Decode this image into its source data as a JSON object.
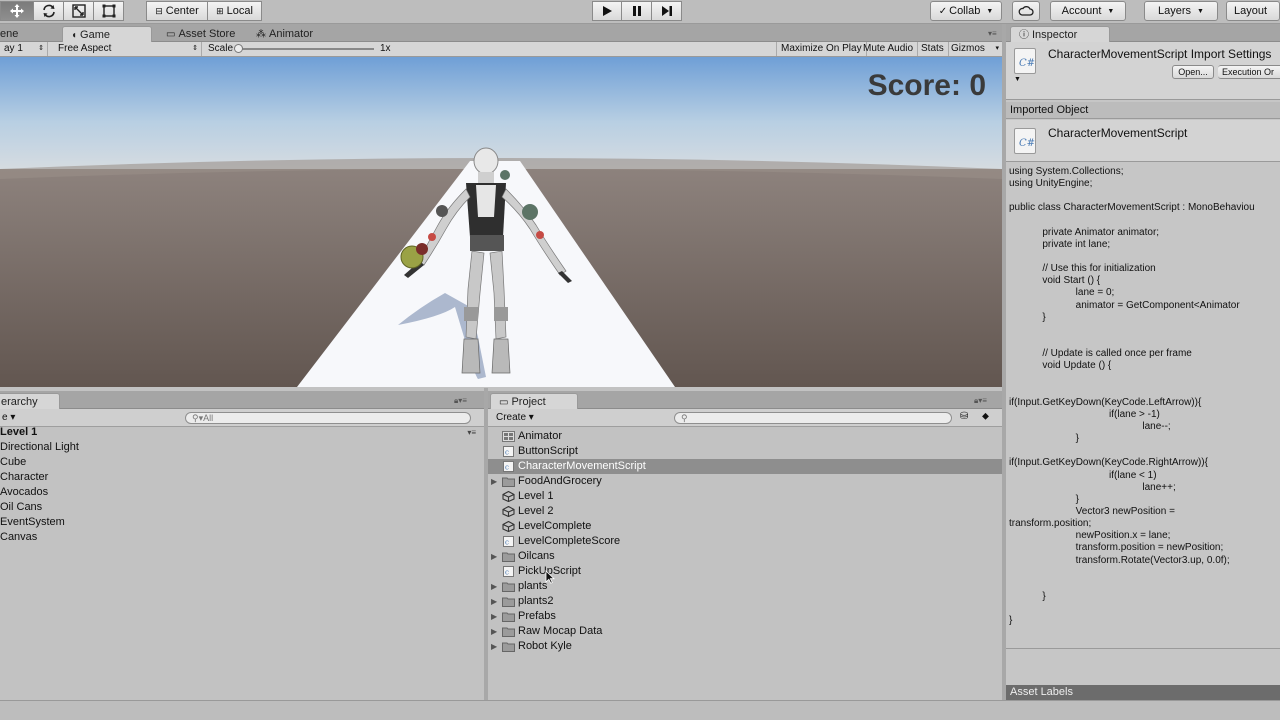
{
  "toolbar": {
    "pivot_label": "Center",
    "rotation_label": "Local",
    "collab_label": "Collab",
    "account_label": "Account",
    "layers_label": "Layers",
    "layout_label": "Layout"
  },
  "tabs": {
    "scene": "ene",
    "game": "Game",
    "asset_store": "Asset Store",
    "animator": "Animator",
    "inspector": "Inspector",
    "hierarchy": "erarchy",
    "project": "Project"
  },
  "game_bar": {
    "display": "ay 1",
    "aspect": "Free Aspect",
    "scale_label": "Scale",
    "scale_value": "1x",
    "maximize": "Maximize On Play",
    "mute": "Mute Audio",
    "stats": "Stats",
    "gizmos": "Gizmos"
  },
  "game_view": {
    "score_text": "Score: 0"
  },
  "hierarchy": {
    "create_label": "e",
    "search_placeholder": "All",
    "scene_name": "Level 1",
    "items": [
      "Directional Light",
      "Cube",
      "Character",
      "Avocados",
      "Oil Cans",
      "EventSystem",
      "Canvas"
    ]
  },
  "project": {
    "create_label": "Create",
    "items": [
      {
        "name": "Animator",
        "icon": "animator-icon"
      },
      {
        "name": "ButtonScript",
        "icon": "csharp-script-icon"
      },
      {
        "name": "CharacterMovementScript",
        "icon": "csharp-script-icon",
        "selected": true
      },
      {
        "name": "FoodAndGrocery",
        "icon": "folder-icon",
        "expandable": true
      },
      {
        "name": "Level 1",
        "icon": "unity-scene-icon"
      },
      {
        "name": "Level 2",
        "icon": "unity-scene-icon"
      },
      {
        "name": "LevelComplete",
        "icon": "unity-scene-icon"
      },
      {
        "name": "LevelCompleteScore",
        "icon": "csharp-script-icon"
      },
      {
        "name": "Oilcans",
        "icon": "folder-icon",
        "expandable": true
      },
      {
        "name": "PickUpScript",
        "icon": "csharp-script-icon"
      },
      {
        "name": "plants",
        "icon": "folder-icon",
        "expandable": true
      },
      {
        "name": "plants2",
        "icon": "folder-icon",
        "expandable": true
      },
      {
        "name": "Prefabs",
        "icon": "folder-icon",
        "expandable": true
      },
      {
        "name": "Raw Mocap Data",
        "icon": "folder-icon",
        "expandable": true
      },
      {
        "name": "Robot Kyle",
        "icon": "folder-icon",
        "expandable": true
      }
    ]
  },
  "inspector": {
    "title": "CharacterMovementScript Import Settings",
    "open_button": "Open...",
    "execution_order_button": "Execution Or",
    "imported_object_label": "Imported Object",
    "object_name": "CharacterMovementScript",
    "icon_glyph": "C#",
    "code_lines": [
      "using System.Collections;",
      "using UnityEngine;",
      "",
      "public class CharacterMovementScript : MonoBehaviou",
      "",
      "            private Animator animator;",
      "            private int lane;",
      "",
      "            // Use this for initialization",
      "            void Start () {",
      "                        lane = 0;",
      "                        animator = GetComponent<Animator",
      "            }",
      "",
      "",
      "            // Update is called once per frame",
      "            void Update () {",
      "",
      "",
      "if(Input.GetKeyDown(KeyCode.LeftArrow)){",
      "                                    if(lane > -1)",
      "                                                lane--;",
      "                        }",
      "",
      "if(Input.GetKeyDown(KeyCode.RightArrow)){",
      "                                    if(lane < 1)",
      "                                                lane++;",
      "                        }",
      "                        Vector3 newPosition =",
      "transform.position;",
      "                        newPosition.x = lane;",
      "                        transform.position = newPosition;",
      "                        transform.Rotate(Vector3.up, 0.0f);",
      "",
      "",
      "            }",
      "",
      "}"
    ],
    "asset_labels": "Asset Labels"
  },
  "colors": {
    "editor_bg": "#c2c2c2",
    "selection": "#8e8e8e",
    "sky_top": "#7ba7d8",
    "ground": "#6d6059",
    "track": "#f7f8fb"
  }
}
